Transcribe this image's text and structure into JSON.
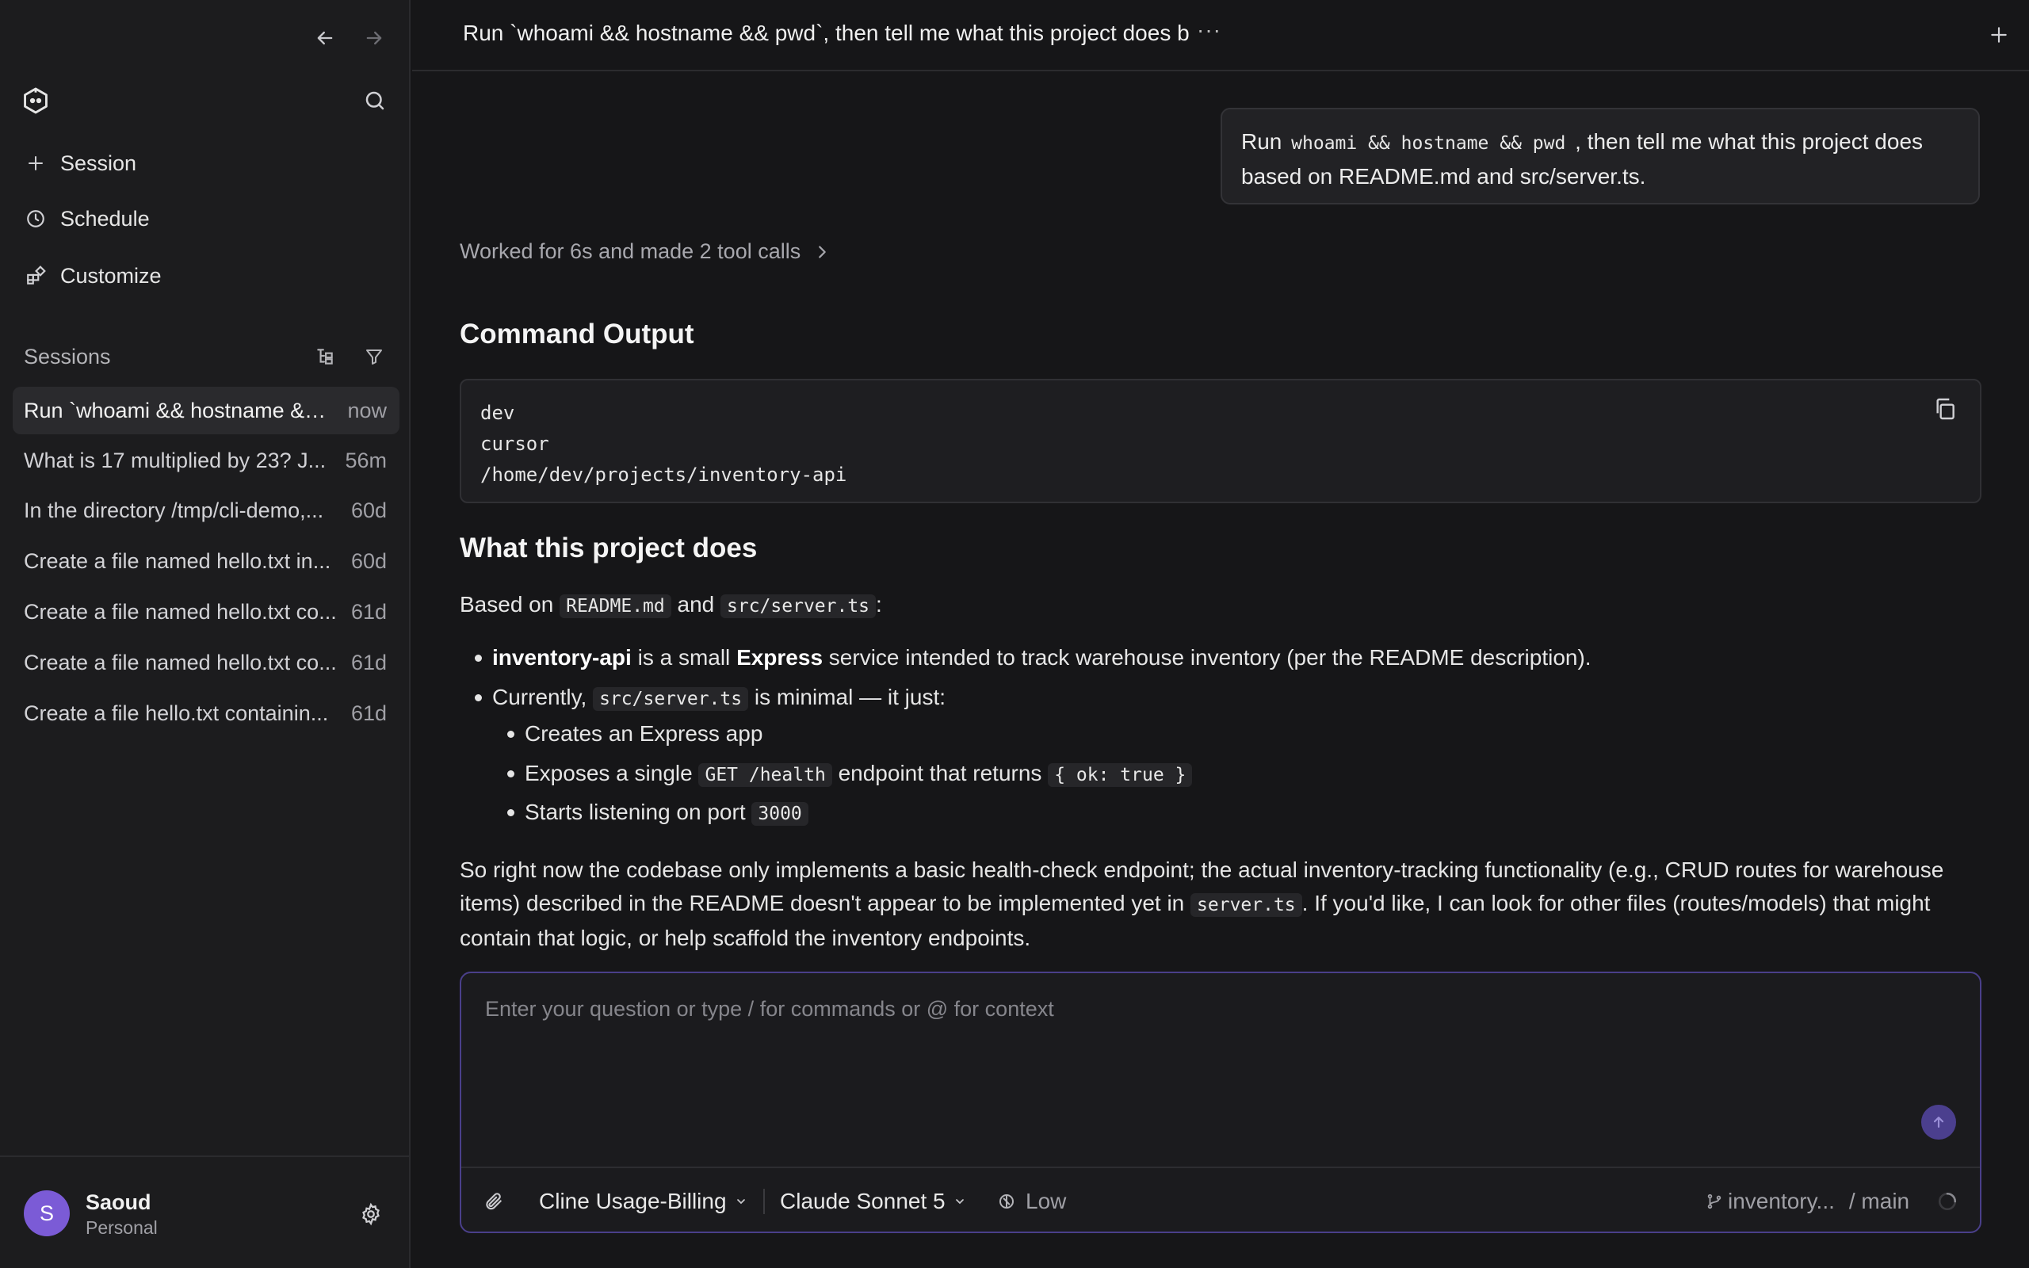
{
  "sidebar": {
    "nav": {
      "session": "Session",
      "schedule": "Schedule",
      "customize": "Customize"
    },
    "sessions_label": "Sessions",
    "sessions": [
      {
        "title": "Run `whoami && hostname &&...",
        "age": "now"
      },
      {
        "title": "What is 17 multiplied by 23? J...",
        "age": "56m"
      },
      {
        "title": "In the directory /tmp/cli-demo,...",
        "age": "60d"
      },
      {
        "title": "Create a file named hello.txt in...",
        "age": "60d"
      },
      {
        "title": "Create a file named hello.txt co...",
        "age": "61d"
      },
      {
        "title": "Create a file named hello.txt co...",
        "age": "61d"
      },
      {
        "title": "Create a file hello.txt containin...",
        "age": "61d"
      }
    ],
    "user": {
      "initial": "S",
      "name": "Saoud",
      "plan": "Personal"
    }
  },
  "header": {
    "title": "Run `whoami && hostname && pwd`, then tell me what this project does b",
    "more": "···"
  },
  "conversation": {
    "user_message": {
      "pre": "Run ",
      "code": "whoami && hostname && pwd",
      "post": " , then tell me what this project does based on README.md and src/server.ts."
    },
    "worked": "Worked for 6s and made 2 tool calls",
    "command_output_heading": "Command Output",
    "command_output_lines": [
      "dev",
      "cursor",
      "/home/dev/projects/inventory-api"
    ],
    "project_heading": "What this project does",
    "based_on": {
      "pre": "Based on ",
      "code1": "README.md",
      "mid": " and ",
      "code2": "src/server.ts",
      "post": ":"
    },
    "bullet1": {
      "bold1": "inventory-api",
      "t1": " is a small ",
      "bold2": "Express",
      "t2": " service intended to track warehouse inventory (per the README description)."
    },
    "bullet2": {
      "pre": "Currently, ",
      "code": "src/server.ts",
      "post": " is minimal — it just:"
    },
    "sub1": "Creates an Express app",
    "sub2": {
      "pre": "Exposes a single ",
      "code1": "GET /health",
      "mid": " endpoint that returns ",
      "code2": "{ ok: true }"
    },
    "sub3": {
      "pre": "Starts listening on port ",
      "code": "3000"
    },
    "summary": {
      "line1": "So right now the codebase only implements a basic health-check endpoint; the actual inventory-tracking functionality (e.g., CRUD routes for warehouse",
      "line2_pre": "items) described in the README doesn't appear to be implemented yet in ",
      "line2_code": "server.ts",
      "line2_post": ". If you'd like, I can look for other files (routes/models) that might",
      "line3": "contain that logic, or help scaffold the inventory endpoints."
    }
  },
  "composer": {
    "placeholder": "Enter your question or type / for commands or @ for context",
    "account": "Cline Usage-Billing",
    "model": "Claude Sonnet 5",
    "effort": "Low",
    "repo": "inventory...",
    "branch": "/ main"
  }
}
